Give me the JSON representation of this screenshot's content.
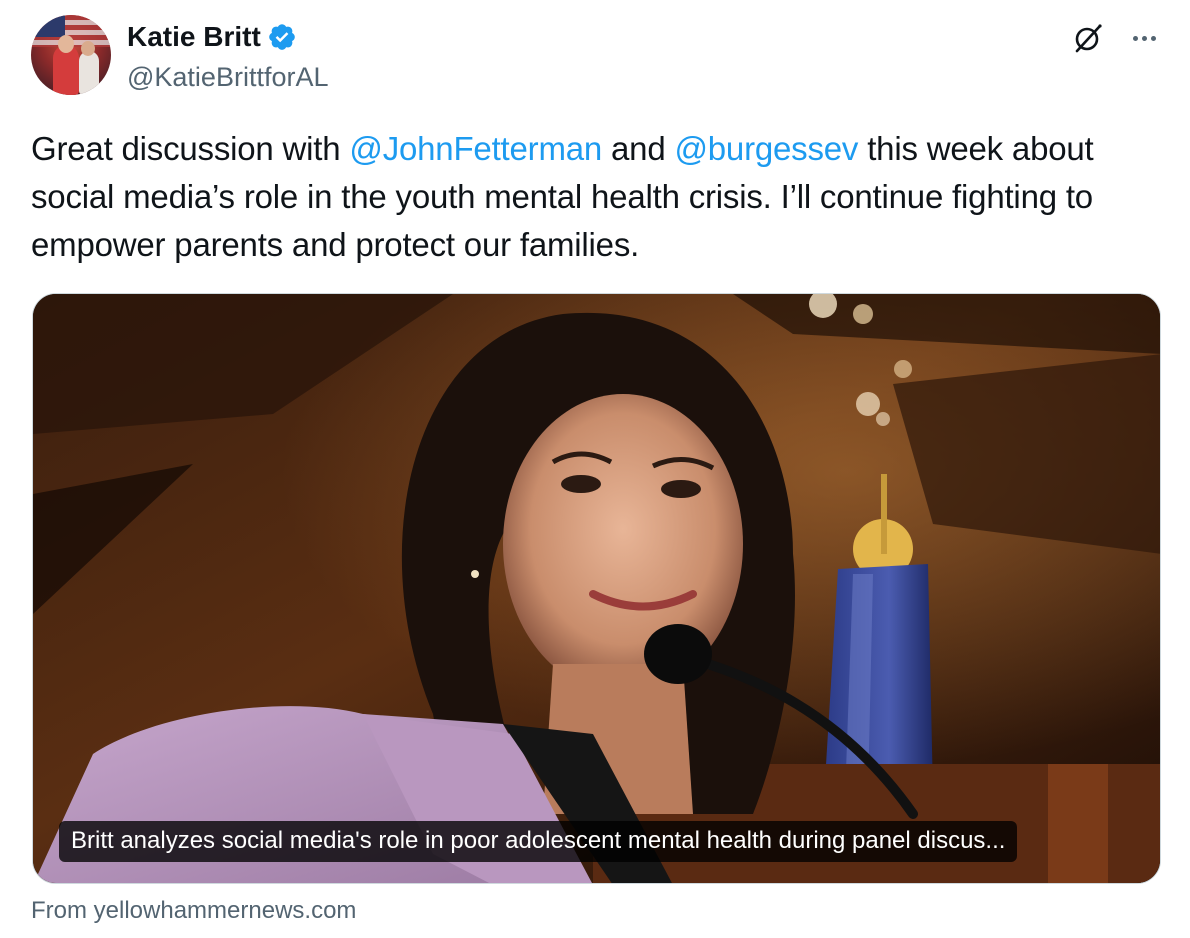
{
  "author": {
    "display_name": "Katie Britt",
    "handle": "@KatieBrittforAL",
    "verified": true,
    "verified_color": "#1d9bf0"
  },
  "actions": {
    "grok_icon": "grok-icon",
    "more_icon": "more-icon"
  },
  "tweet": {
    "text_before_mention_1": "Great discussion with ",
    "mention_1": "@JohnFetterman",
    "text_between_mentions": " and ",
    "mention_2": "@burgessev",
    "text_after_mentions": " this week about social media’s role in the youth mental health crisis. I’ll continue fighting to empower parents and protect our families."
  },
  "link_card": {
    "caption": "Britt analyzes social media's role in poor adolescent mental health during panel discus...",
    "source": "From yellowhammernews.com"
  },
  "colors": {
    "text": "#0f1419",
    "secondary": "#536471",
    "accent": "#1d9bf0"
  }
}
